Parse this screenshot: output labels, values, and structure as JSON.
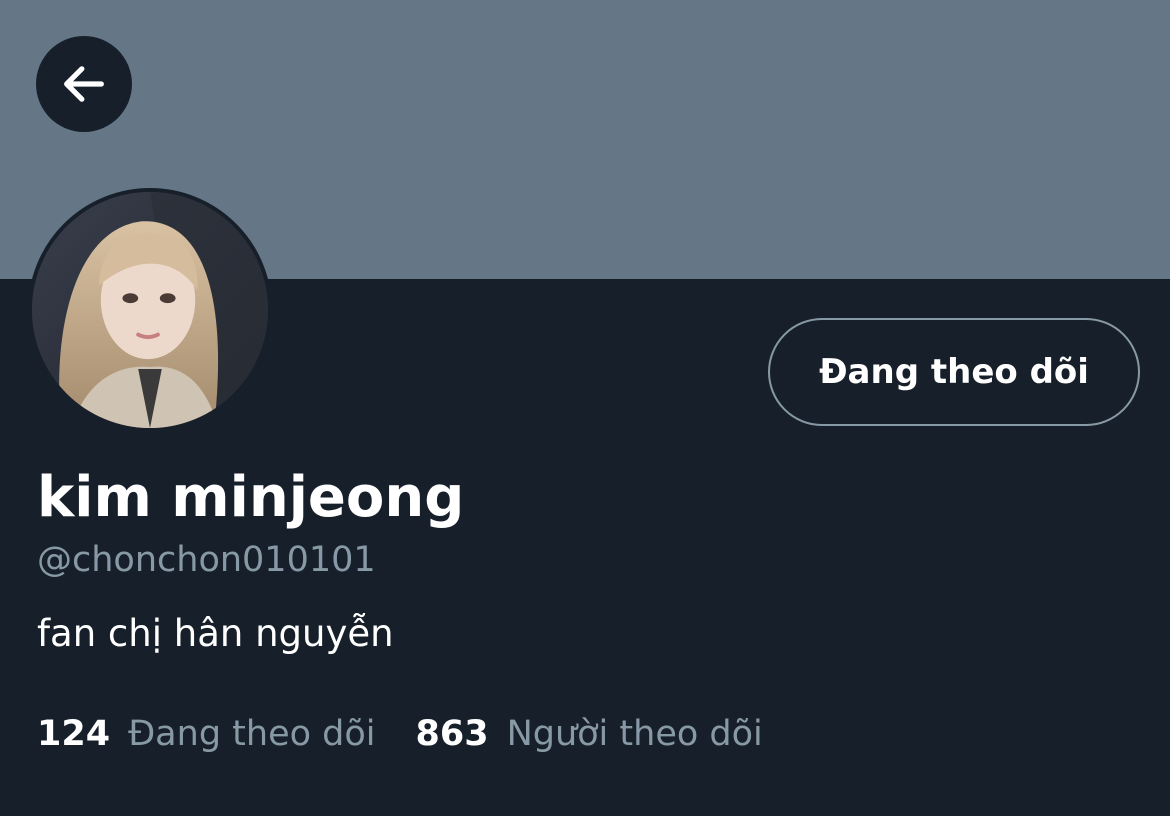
{
  "header": {
    "back_icon": "arrow-left-icon",
    "banner_color": "#657786"
  },
  "profile": {
    "display_name": "kim minjeong",
    "handle": "@chonchon010101",
    "bio": "fan chị hân nguyễn",
    "follow_button_label": "Đang theo dõi"
  },
  "stats": {
    "following_count": "124",
    "following_label": "Đang theo dõi",
    "followers_count": "863",
    "followers_label": "Người theo dõi"
  },
  "colors": {
    "background": "#17202a",
    "secondary_text": "#8899a6",
    "primary_text": "#ffffff"
  }
}
